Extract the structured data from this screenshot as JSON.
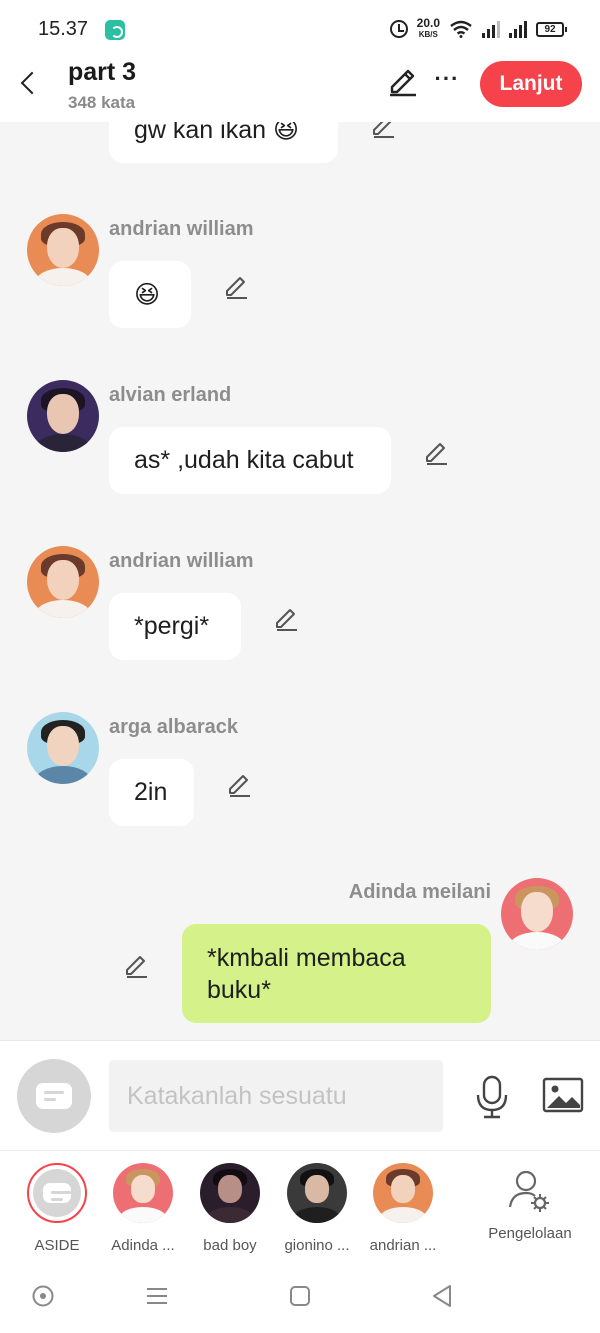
{
  "status_bar": {
    "time": "15.37",
    "speed_value": "20.0",
    "speed_unit": "KB/S",
    "battery": "92"
  },
  "header": {
    "title": "part 3",
    "word_count": "348 kata",
    "next_label": "Lanjut"
  },
  "messages": [
    {
      "sender": "",
      "text": "gw kan ikan 😆",
      "side": "left"
    },
    {
      "sender": "andrian william",
      "text": "😆",
      "side": "left"
    },
    {
      "sender": "alvian erland",
      "text": "as* ,udah kita cabut",
      "side": "left"
    },
    {
      "sender": "andrian william",
      "text": "*pergi*",
      "side": "left"
    },
    {
      "sender": "arga albarack",
      "text": "2in",
      "side": "left"
    },
    {
      "sender": "Adinda meilani",
      "text": "*kmbali membaca buku*",
      "side": "right"
    }
  ],
  "composer": {
    "placeholder": "Katakanlah sesuatu"
  },
  "characters": [
    {
      "name": "ASIDE",
      "selected": true
    },
    {
      "name": "Adinda ..."
    },
    {
      "name": "bad boy"
    },
    {
      "name": "gionino ..."
    },
    {
      "name": "andrian ..."
    }
  ],
  "manage_label": "Pengelolaan",
  "colors": {
    "accent": "#f5424b",
    "own_bubble": "#d5f28a",
    "bubble": "#ffffff",
    "background": "#f5f5f5"
  }
}
